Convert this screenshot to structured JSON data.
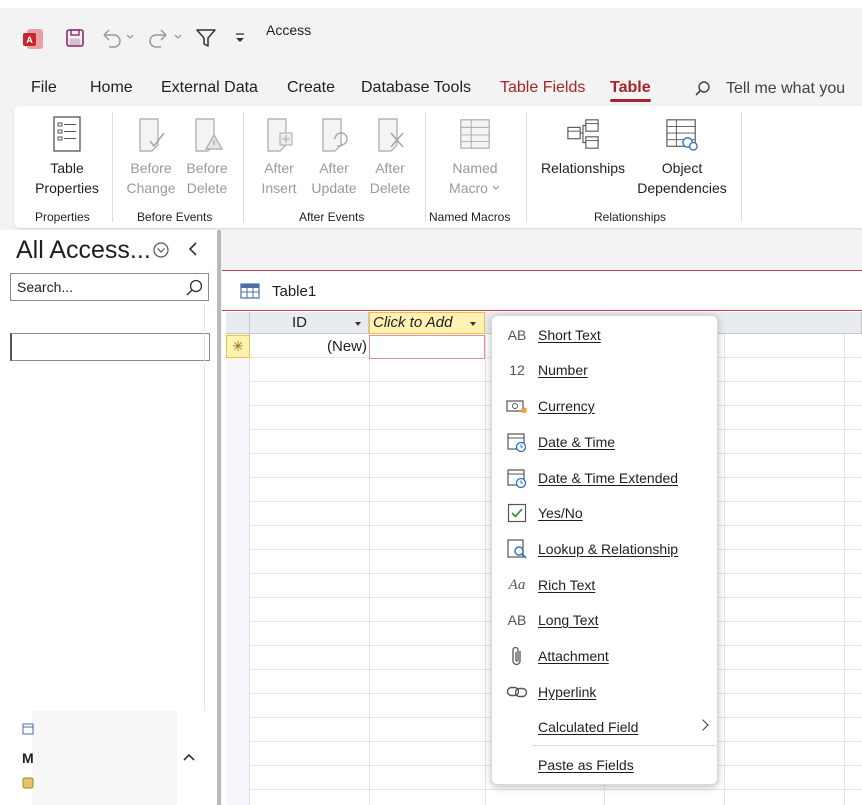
{
  "app": {
    "title": "Access"
  },
  "menu": {
    "tabs": [
      {
        "label": "File"
      },
      {
        "label": "Home"
      },
      {
        "label": "External Data"
      },
      {
        "label": "Create"
      },
      {
        "label": "Database Tools"
      },
      {
        "label": "Table Fields"
      },
      {
        "label": "Table"
      }
    ],
    "active_tab": "Table",
    "tell_me": "Tell me what you"
  },
  "ribbon": {
    "groups": [
      {
        "label": "Properties"
      },
      {
        "label": "Before Events"
      },
      {
        "label": "After Events"
      },
      {
        "label": "Named Macros"
      },
      {
        "label": "Relationships"
      }
    ],
    "buttons": {
      "table_properties": [
        "Table",
        "Properties"
      ],
      "before_change": [
        "Before",
        "Change"
      ],
      "before_delete": [
        "Before",
        "Delete"
      ],
      "after_insert": [
        "After",
        "Insert"
      ],
      "after_update": [
        "After",
        "Update"
      ],
      "after_delete": [
        "After",
        "Delete"
      ],
      "named_macro": [
        "Named",
        "Macro"
      ],
      "relationships": [
        "Relationships"
      ],
      "object_dependencies": [
        "Object",
        "Dependencies"
      ]
    }
  },
  "nav_pane": {
    "title": "All Access...",
    "search_placeholder": "Search...",
    "bottom_letter": "M"
  },
  "document": {
    "tab_title": "Table1",
    "columns": [
      {
        "label": "ID"
      },
      {
        "label": "Click to Add"
      }
    ],
    "new_row": {
      "id": "(New)"
    }
  },
  "context_menu": {
    "items": [
      {
        "icon": "AB",
        "label": "Short Text",
        "type": "short-text"
      },
      {
        "icon": "12",
        "label": "Number",
        "type": "number"
      },
      {
        "icon": "",
        "label": "Currency",
        "type": "currency"
      },
      {
        "icon": "",
        "label": "Date & Time",
        "type": "date-time"
      },
      {
        "icon": "",
        "label": "Date & Time Extended",
        "type": "date-time-extended"
      },
      {
        "icon": "",
        "label": "Yes/No",
        "type": "yes-no"
      },
      {
        "icon": "",
        "label": "Lookup & Relationship",
        "type": "lookup"
      },
      {
        "icon": "Aa",
        "label": "Rich Text",
        "type": "rich-text"
      },
      {
        "icon": "AB",
        "label": "Long Text",
        "type": "long-text"
      },
      {
        "icon": "",
        "label": "Attachment",
        "type": "attachment"
      },
      {
        "icon": "",
        "label": "Hyperlink",
        "type": "hyperlink"
      },
      {
        "icon": "",
        "label": "Calculated Field",
        "type": "calculated"
      },
      {
        "icon": "",
        "label": "Paste as Fields",
        "type": "paste-as-fields"
      }
    ]
  },
  "colors": {
    "accent": "#a4262c",
    "ribbon_bg": "#f3f3f3",
    "highlight": "#fff2b3"
  }
}
